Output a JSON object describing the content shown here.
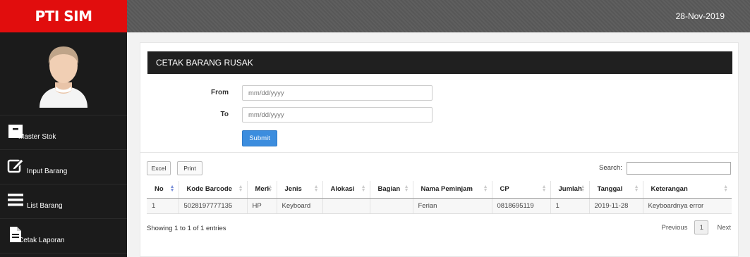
{
  "app": {
    "brand": "PTI SIM",
    "date": "28-Nov-2019"
  },
  "sidebar": {
    "items": [
      {
        "label": "Master Stok",
        "icon": "archive-icon"
      },
      {
        "label": "Input Barang",
        "icon": "edit-icon"
      },
      {
        "label": "List Barang",
        "icon": "list-icon"
      },
      {
        "label": "Cetak Laporan",
        "icon": "document-icon"
      }
    ]
  },
  "form": {
    "title": "CETAK BARANG RUSAK",
    "from_label": "From",
    "from_placeholder": "mm/dd/yyyy",
    "to_label": "To",
    "to_placeholder": "mm/dd/yyyy",
    "submit_label": "Submit"
  },
  "table": {
    "excel_label": "Excel",
    "print_label": "Print",
    "search_label": "Search:",
    "columns": [
      "No",
      "Kode Barcode",
      "Merk",
      "Jenis",
      "Alokasi",
      "Bagian",
      "Nama Peminjam",
      "CP",
      "Jumlah",
      "Tanggal",
      "Keterangan"
    ],
    "rows": [
      [
        "1",
        "5028197777135",
        "HP",
        "Keyboard",
        "",
        "",
        "Ferian",
        "0818695119",
        "1",
        "2019-11-28",
        "Keyboardnya error"
      ]
    ],
    "info": "Showing 1 to 1 of 1 entries",
    "pager": {
      "previous": "Previous",
      "page": "1",
      "next": "Next"
    }
  }
}
